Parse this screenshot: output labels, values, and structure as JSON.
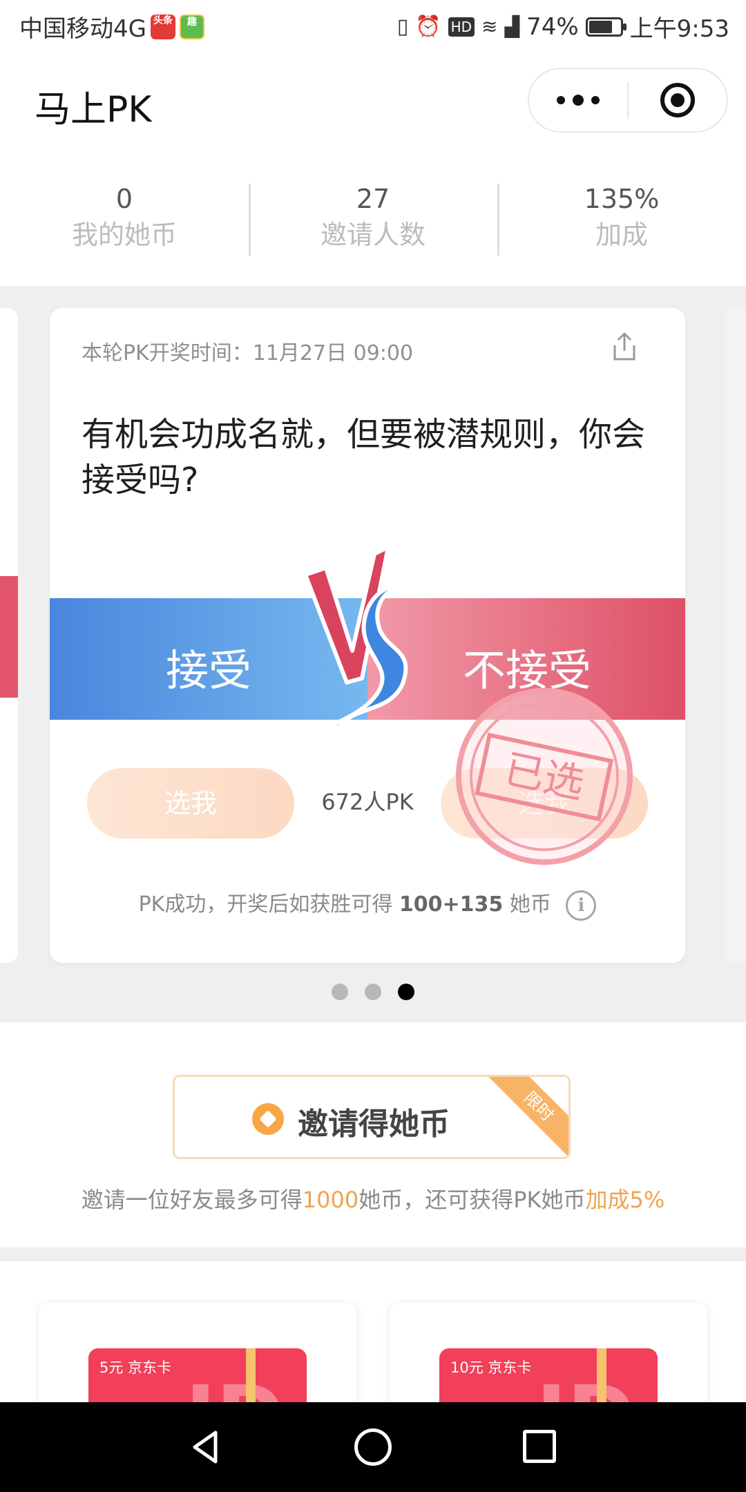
{
  "status_bar": {
    "carrier": "中国移动4G",
    "app_icon_1": "头条",
    "app_icon_2": "趣",
    "battery": "74%",
    "battery_level": 0.74,
    "time": "上午9:53",
    "icons": [
      "vibrate-icon",
      "alarm-icon",
      "hd-icon",
      "wifi-icon",
      "signal-icon",
      "battery-icon"
    ]
  },
  "header": {
    "title": "马上PK"
  },
  "stats": [
    {
      "value": "0",
      "label": "我的她币"
    },
    {
      "value": "27",
      "label": "邀请人数"
    },
    {
      "value": "135%",
      "label": "加成"
    }
  ],
  "card": {
    "draw_time": "本轮PK开奖时间：11月27日 09:00",
    "question": "有机会功成名就，但要被潜规则，你会接受吗?",
    "option_left": "接受",
    "option_right": "不接受",
    "choose_left": "选我",
    "choose_right": "选我",
    "pk_count": "672人PK",
    "stamp": "已选",
    "reward_prefix": "PK成功，开奖后如获胜可得",
    "reward_amount": "100+135",
    "reward_suffix": "她币",
    "colors": {
      "left": "#4a86dd",
      "right": "#de5067"
    }
  },
  "carousel": {
    "pages": 3,
    "active_index": 2
  },
  "invite": {
    "button_label": "邀请得她币",
    "ribbon": "限时",
    "desc_1": "邀请一位好友最多可得",
    "desc_amount": "1000",
    "desc_2": "她币，还可获得PK她币",
    "desc_bonus": "加成5%",
    "accent": "#eea44e"
  },
  "gifts": [
    {
      "label": "5元 京东卡",
      "logo": "JD"
    },
    {
      "label": "10元 京东卡",
      "logo": "JD"
    }
  ]
}
